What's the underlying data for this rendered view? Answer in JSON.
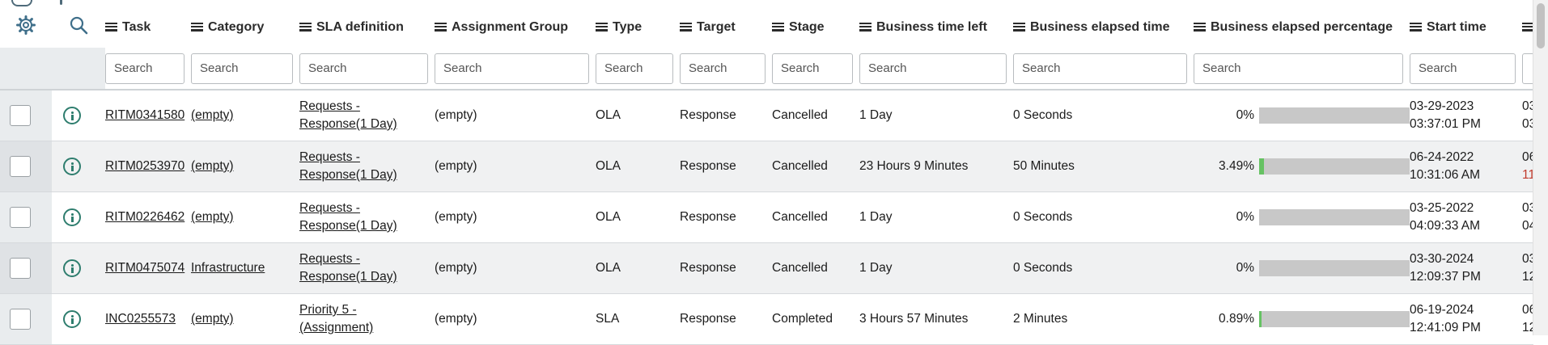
{
  "list": {
    "columns": [
      {
        "key": "task",
        "label": "Task"
      },
      {
        "key": "category",
        "label": "Category"
      },
      {
        "key": "sla",
        "label": "SLA definition"
      },
      {
        "key": "group",
        "label": "Assignment Group"
      },
      {
        "key": "type",
        "label": "Type"
      },
      {
        "key": "target",
        "label": "Target"
      },
      {
        "key": "stage",
        "label": "Stage"
      },
      {
        "key": "time_left",
        "label": "Business time left"
      },
      {
        "key": "elapsed",
        "label": "Business elapsed time"
      },
      {
        "key": "elapsed_pct",
        "label": "Business elapsed percentage"
      },
      {
        "key": "start",
        "label": "Start time"
      },
      {
        "key": "end",
        "label": ""
      }
    ],
    "search_placeholder": "Search",
    "rows": [
      {
        "task": "RITM0341580",
        "category": "(empty)",
        "sla": "Requests - Response(1 Day)",
        "group": "(empty)",
        "type": "OLA",
        "target": "Response",
        "stage": "Cancelled",
        "time_left": "1 Day",
        "elapsed": "0 Seconds",
        "elapsed_pct": "0%",
        "pct_value": 0,
        "start_date": "03-29-2023",
        "start_time": "03:37:01 PM",
        "end_date": "03",
        "end_time": "03"
      },
      {
        "task": "RITM0253970",
        "category": "(empty)",
        "sla": "Requests - Response(1 Day)",
        "group": "(empty)",
        "type": "OLA",
        "target": "Response",
        "stage": "Cancelled",
        "time_left": "23 Hours 9 Minutes",
        "elapsed": "50 Minutes",
        "elapsed_pct": "3.49%",
        "pct_value": 3.49,
        "start_date": "06-24-2022",
        "start_time": "10:31:06 AM",
        "end_date": "06",
        "end_time": "11"
      },
      {
        "task": "RITM0226462",
        "category": "(empty)",
        "sla": "Requests - Response(1 Day)",
        "group": "(empty)",
        "type": "OLA",
        "target": "Response",
        "stage": "Cancelled",
        "time_left": "1 Day",
        "elapsed": "0 Seconds",
        "elapsed_pct": "0%",
        "pct_value": 0,
        "start_date": "03-25-2022",
        "start_time": "04:09:33 AM",
        "end_date": "03",
        "end_time": "04"
      },
      {
        "task": "RITM0475074",
        "category": "Infrastructure",
        "sla": "Requests - Response(1 Day)",
        "group": "(empty)",
        "type": "OLA",
        "target": "Response",
        "stage": "Cancelled",
        "time_left": "1 Day",
        "elapsed": "0 Seconds",
        "elapsed_pct": "0%",
        "pct_value": 0,
        "start_date": "03-30-2024",
        "start_time": "12:09:37 PM",
        "end_date": "03",
        "end_time": "12"
      },
      {
        "task": "INC0255573",
        "category": "(empty)",
        "sla": "Priority 5 - (Assignment)",
        "group": "(empty)",
        "type": "SLA",
        "target": "Response",
        "stage": "Completed",
        "time_left": "3 Hours 57 Minutes",
        "elapsed": "2 Minutes",
        "elapsed_pct": "0.89%",
        "pct_value": 0.89,
        "start_date": "06-19-2024",
        "start_time": "12:41:09 PM",
        "end_date": "06",
        "end_time": "12"
      }
    ]
  },
  "colors": {
    "progress_fill": "#66c263",
    "progress_track": "#c8c8c8",
    "info_icon": "#2e7d6e",
    "gear_icon": "#3f6f8a"
  },
  "icons": {
    "personalize": "gear-icon",
    "search": "search-icon",
    "row_info": "info-icon"
  }
}
